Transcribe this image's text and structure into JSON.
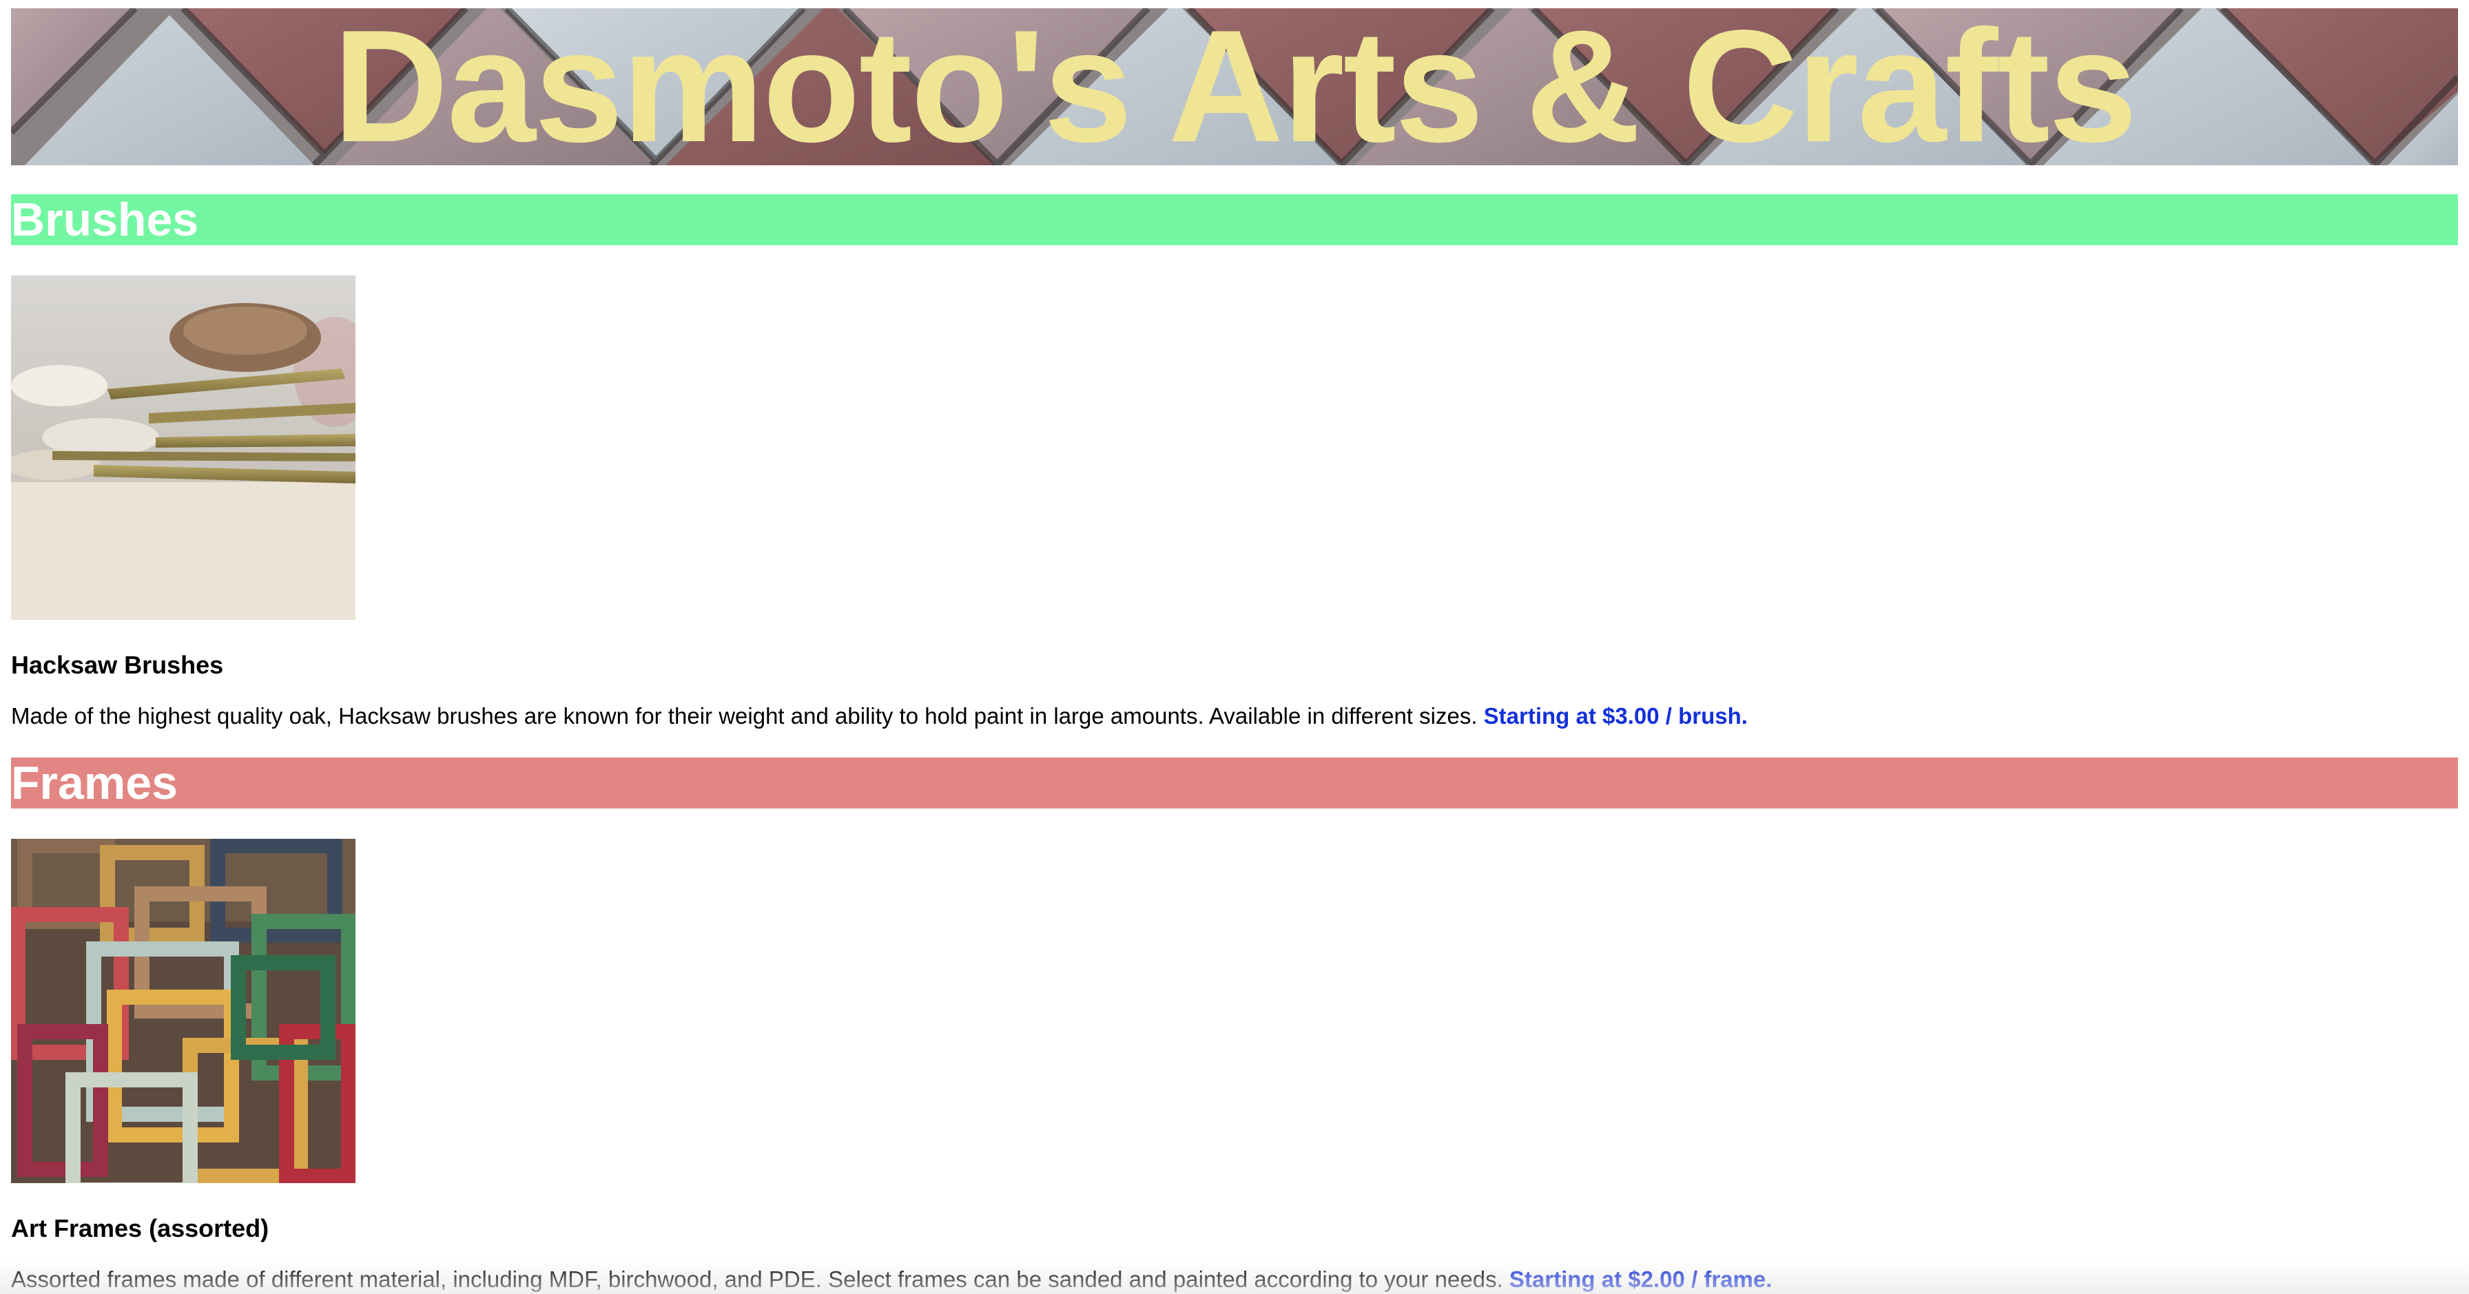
{
  "header": {
    "title": "Dasmoto's Arts & Crafts",
    "title_color": "#efe595"
  },
  "sections": [
    {
      "heading": "Brushes",
      "heading_color": "#73f6a2",
      "image_icon": "paint-brushes-photo",
      "product_title": "Hacksaw Brushes",
      "description": "Made of the highest quality oak, Hacksaw brushes are known for their weight and ability to hold paint in large amounts. Available in different sizes.",
      "price": "Starting at $3.00 / brush."
    },
    {
      "heading": "Frames",
      "heading_color": "#e28684",
      "image_icon": "art-frames-photo",
      "product_title": "Art Frames (assorted)",
      "description": "Assorted frames made of different material, including MDF, birchwood, and PDE. Select frames can be sanded and painted according to your needs.",
      "price": "Starting at $2.00 / frame."
    }
  ],
  "colors": {
    "price_link": "#1330d9",
    "heading_text": "#ffffff"
  }
}
